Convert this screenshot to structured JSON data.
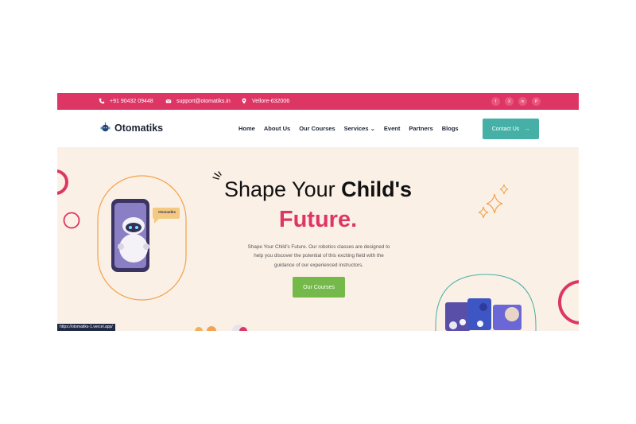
{
  "topbar": {
    "phone": "+91 90432 09448",
    "email": "support@otomatiks.in",
    "location": "Vellore-632006",
    "social_icons": [
      "facebook-icon",
      "x-icon",
      "linkedin-icon",
      "pinterest-icon"
    ],
    "social_glyphs": [
      "f",
      "X",
      "in",
      "P"
    ]
  },
  "nav": {
    "brand": "Otomatiks",
    "items": [
      "Home",
      "About Us",
      "Our Courses",
      "Services",
      "Event",
      "Partners",
      "Blogs"
    ],
    "services_caret": "⌄",
    "contact_label": "Contact Us",
    "contact_arrow": "→"
  },
  "hero": {
    "title_line1_regular": "Shape Your ",
    "title_line1_bold": "Child's",
    "title_line2": "Future.",
    "description": "Shape Your Child's Future. Our robotics classes are designed to help you discover the potential of this exciting field with the guidance of our experienced instructors.",
    "cta_label": "Our Courses",
    "phone_bubble": "Otomatiks"
  },
  "status_bar": {
    "url": "https://otomatiks-1.vercel.app/"
  },
  "colors": {
    "brand_pink": "#dd3664",
    "teal": "#46b0a7",
    "green": "#74b94a",
    "hero_bg": "#fbf0e6",
    "orange_outline": "#f1a24b"
  }
}
